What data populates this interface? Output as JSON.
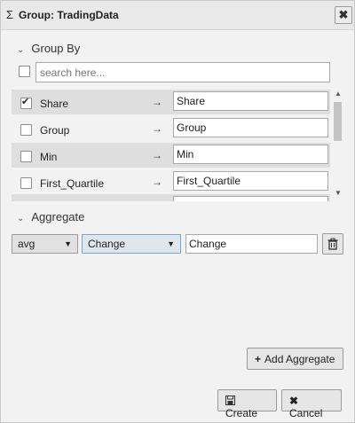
{
  "dialog": {
    "title_icon": "Σ",
    "title": "Group: TradingData",
    "close_symbol": "✖"
  },
  "group_by": {
    "header": "Group By",
    "search_placeholder": "search here...",
    "rows": [
      {
        "label": "Share",
        "checked": true,
        "arrow": "→",
        "value": "Share"
      },
      {
        "label": "Group",
        "checked": false,
        "arrow": "→",
        "value": "Group"
      },
      {
        "label": "Min",
        "checked": false,
        "arrow": "→",
        "value": "Min"
      },
      {
        "label": "First_Quartile",
        "checked": false,
        "arrow": "→",
        "value": "First_Quartile"
      }
    ]
  },
  "aggregate": {
    "header": "Aggregate",
    "function_selected": "avg",
    "column_selected": "Change",
    "output_name": "Change"
  },
  "buttons": {
    "add_aggregate": "Add Aggregate",
    "create": "Create",
    "cancel": "Cancel"
  },
  "icons": {
    "chevron": "chevron-down-icon",
    "close": "close-icon",
    "trash": "trash-icon",
    "plus": "plus-icon",
    "save": "save-icon",
    "cancel": "x-icon"
  }
}
